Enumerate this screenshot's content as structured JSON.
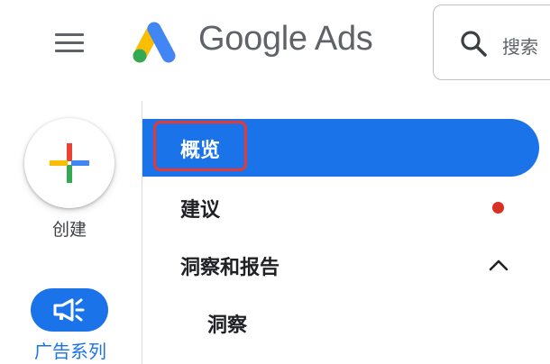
{
  "header": {
    "brand": "Google Ads",
    "search_placeholder": "搜索"
  },
  "rail": {
    "create_label": "创建",
    "campaigns_label": "广告系列"
  },
  "nav": {
    "overview": "概览",
    "recommendations": "建议",
    "insights_reports": "洞察和报告",
    "insights": "洞察"
  },
  "colors": {
    "accent": "#1a73e8",
    "highlight": "#e53935",
    "notification_dot": "#d93025"
  }
}
